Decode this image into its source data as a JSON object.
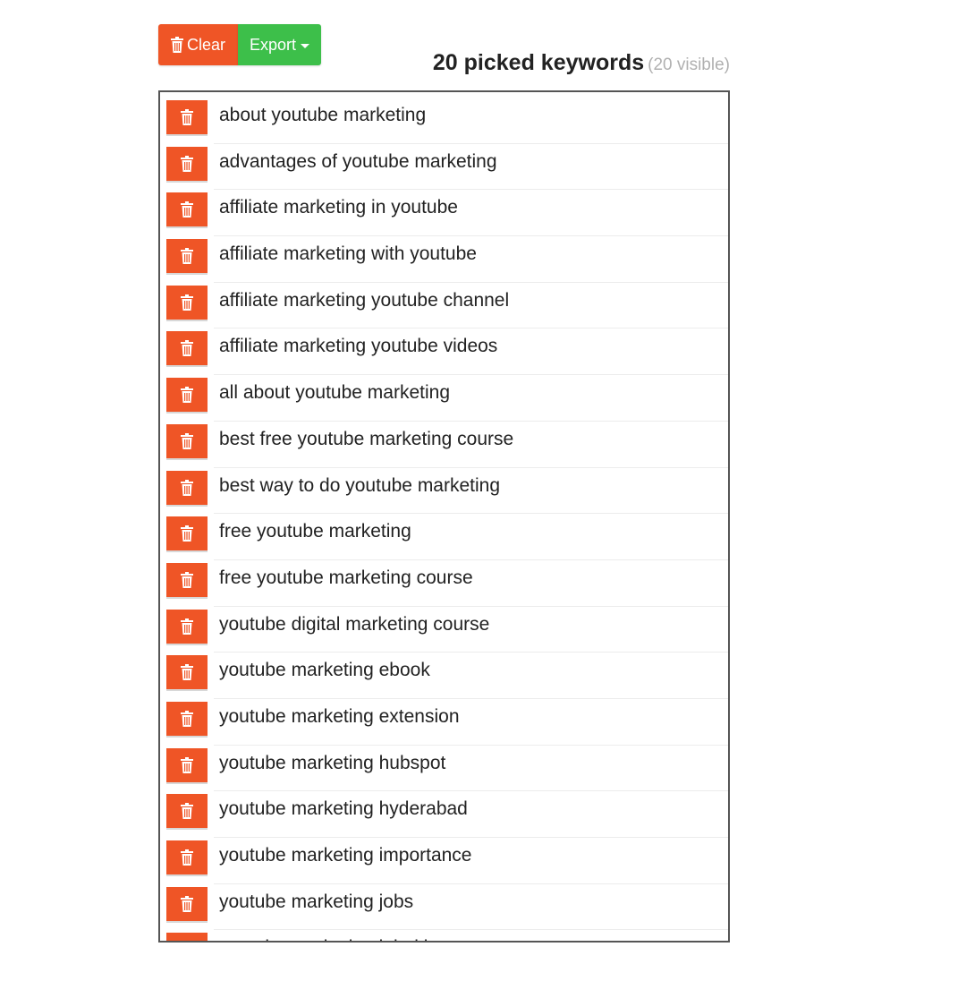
{
  "toolbar": {
    "clear_label": "Clear",
    "export_label": "Export",
    "clear_color": "#ef5526",
    "export_color": "#3dbf4a"
  },
  "heading": {
    "count_text": "20 picked keywords",
    "visible_text": "(20 visible)"
  },
  "keywords": [
    "about youtube marketing",
    "advantages of youtube marketing",
    "affiliate marketing in youtube",
    "affiliate marketing with youtube",
    "affiliate marketing youtube channel",
    "affiliate marketing youtube videos",
    "all about youtube marketing",
    "best free youtube marketing course",
    "best way to do youtube marketing",
    "free youtube marketing",
    "free youtube marketing course",
    "youtube digital marketing course",
    "youtube marketing ebook",
    "youtube marketing extension",
    "youtube marketing hubspot",
    "youtube marketing hyderabad",
    "youtube marketing importance",
    "youtube marketing jobs",
    "youtube marketing job titles"
  ],
  "icons": {
    "delete": "trash-icon",
    "dropdown": "caret-down-icon"
  }
}
